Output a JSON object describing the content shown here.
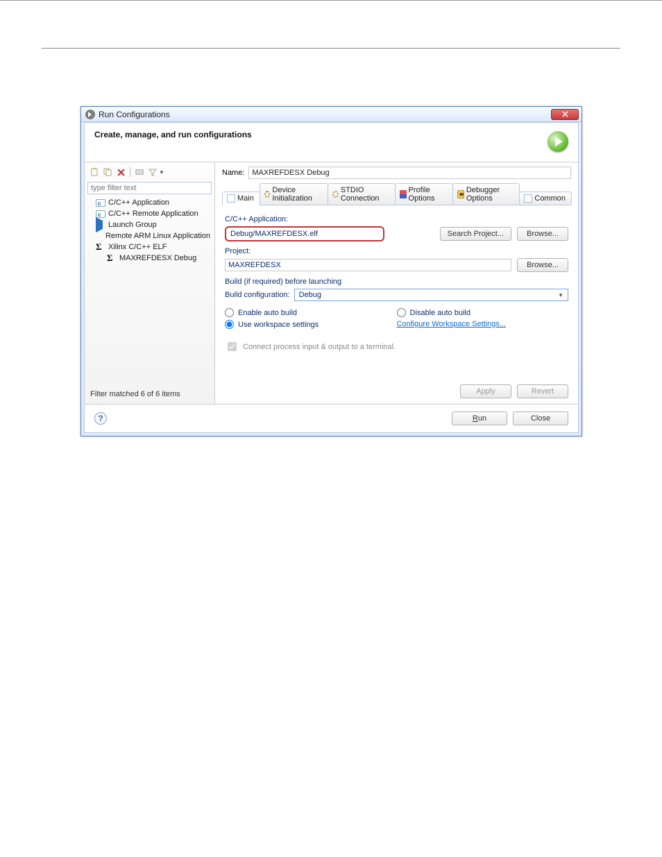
{
  "window": {
    "title": "Run Configurations",
    "subtitle": "Create, manage, and run configurations"
  },
  "leftPane": {
    "filterPlaceholder": "type filter text",
    "tree": [
      {
        "label": "C/C++ Application",
        "icon": "capp"
      },
      {
        "label": "C/C++ Remote Application",
        "icon": "capp"
      },
      {
        "label": "Launch Group",
        "icon": "launch"
      },
      {
        "label": "Remote ARM Linux Application",
        "icon": "arm"
      },
      {
        "label": "Xilinx C/C++ ELF",
        "icon": "sigma"
      }
    ],
    "childItem": {
      "label": "MAXREFDESX Debug",
      "icon": "sigma"
    },
    "filterStatus": "Filter matched 6 of 6 items"
  },
  "rightPane": {
    "nameLabel": "Name:",
    "nameValue": "MAXREFDESX Debug",
    "tabs": [
      {
        "label": "Main",
        "icon": "doc",
        "active": true
      },
      {
        "label": "Device Initialization",
        "icon": "gear"
      },
      {
        "label": "STDIO Connection",
        "icon": "conn"
      },
      {
        "label": "Profile Options",
        "icon": "prof"
      },
      {
        "label": "Debugger Options",
        "icon": "bug"
      },
      {
        "label": "Common",
        "icon": "com"
      }
    ],
    "cppAppLabel": "C/C++ Application:",
    "cppAppValue": "Debug/MAXREFDESX.elf",
    "searchProjectBtn": "Search Project...",
    "browseBtn": "Browse...",
    "projectLabel": "Project:",
    "projectValue": "MAXREFDESX",
    "buildSection": "Build (if required) before launching",
    "buildConfigLabel": "Build configuration:",
    "buildConfigValue": "Debug",
    "enableAutoBuild": "Enable auto build",
    "disableAutoBuild": "Disable auto build",
    "useWorkspace": "Use workspace settings",
    "configureLink": "Configure Workspace Settings...",
    "connectTerminal": "Connect process input & output to a terminal.",
    "applyBtn": "Apply",
    "revertBtn": "Revert"
  },
  "footer": {
    "runBtn": "Run",
    "closeBtn": "Close"
  }
}
